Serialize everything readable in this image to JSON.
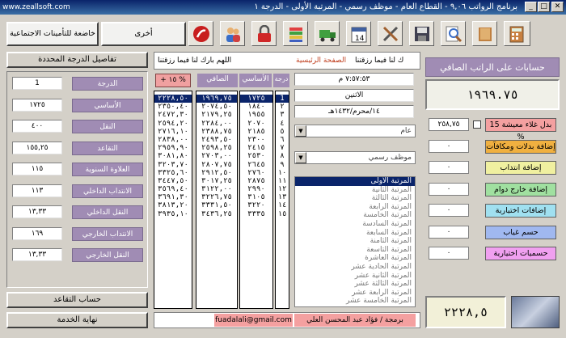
{
  "window": {
    "title": "برنامج الرواتب ٩,٠٦ - القطاع العام - موظف رسمي - المرتبة الأولى - الدرجة ١",
    "watermark": "www.zeallsoft.com",
    "min": "_",
    "max": "□",
    "close": "✕"
  },
  "toolbar": {
    "subject_label": "خاضعة للتأمينات الاجتماعية",
    "other_label": "أخرى",
    "icons": [
      "calculator-icon",
      "book-icon",
      "search-icon",
      "save-icon",
      "tools-icon",
      "calendar-icon",
      "truck-icon",
      "files-icon",
      "lock-icon",
      "users-icon",
      "help-icon"
    ]
  },
  "left": {
    "details_button": "تفاصيل الدرجة المحددة",
    "fields": [
      {
        "label": "الدرجة",
        "value": "1"
      },
      {
        "label": "الأساسي",
        "value": "١٧٢٥"
      },
      {
        "label": "النقل",
        "value": "٤٠٠"
      },
      {
        "label": "التقاعد",
        "value": "١٥٥,٢٥"
      },
      {
        "label": "العلاوة السنوية",
        "value": "١١٥"
      },
      {
        "label": "الانتداب الداخلي",
        "value": "١١٣"
      },
      {
        "label": "النقل الداخلي",
        "value": "١٣,٣٣"
      },
      {
        "label": "الانتداب الخارجي",
        "value": "١٦٩"
      },
      {
        "label": "النقل الخارجي",
        "value": "١٣,٣٣"
      }
    ],
    "retirement_button": "حساب التقاعد",
    "end_service_button": "نهاية الخدمة"
  },
  "center": {
    "marquee": "اللهم بارك لنا فيما رزقتنا",
    "marquee_main": "الصفحة الرئيسية",
    "marquee_tail": "ك لنا فيما رزقتنا",
    "plus_button": "+ ١٥ %",
    "headers": {
      "net": "الصافي",
      "basic": "الأساسي",
      "grade": "درجة"
    },
    "col_plus": [
      "٢٢٢٨,٥٠",
      "٢٣٥٠,٤٠",
      "٢٤٧٢,٣٠",
      "٢٥٩٤,٢٠",
      "٢٧١٦,١٠",
      "٢٨٣٨,٠٠",
      "٢٩٥٩,٩٠",
      "٣٠٨١,٨٠",
      "٣٢٠٣,٧٠",
      "٣٣٢٥,٦٠",
      "٣٤٤٧,٥٠",
      "٣٥٦٩,٤٠",
      "٣٦٩١,٣٠",
      "٣٨١٣,٢٠",
      "٣٩٣٥,١٠"
    ],
    "col_net": [
      "١٩٦٩,٧٥",
      "٢٠٧٤,٥٠",
      "٢١٧٩,٢٥",
      "٢٢٨٤,٠٠",
      "٢٣٨٨,٧٥",
      "٢٤٩٣,٥٠",
      "٢٥٩٨,٢٥",
      "٢٧٠٣,٠٠",
      "٢٨٠٧,٧٥",
      "٢٩١٢,٥٠",
      "٣٠١٧,٢٥",
      "٣١٢٢,٠٠",
      "٣٢٢٦,٧٥",
      "٣٣٣١,٥٠",
      "٣٤٣٦,٢٥"
    ],
    "col_basic": [
      "١٧٢٥",
      "١٨٤٠",
      "١٩٥٥",
      "٢٠٧٠",
      "٢١٨٥",
      "٢٣٠٠",
      "٢٤١٥",
      "٢٥٣٠",
      "٢٦٤٥",
      "٢٧٦٠",
      "٢٨٧٥",
      "٢٩٩٠",
      "٣١٠٥",
      "٣٢٢٠",
      "٣٣٣٥"
    ],
    "col_grade": [
      "1",
      "٢",
      "٣",
      "٤",
      "٥",
      "٦",
      "٧",
      "٨",
      "٩",
      "١٠",
      "١١",
      "١٢",
      "١٣",
      "١٤",
      "١٥"
    ],
    "time": "٧:٥٧:٥٣ م",
    "day": "الاثنين",
    "date": "١٤/محرم/١٤٣٢هـ",
    "combo_sector": "عام",
    "combo_type": "موظف رسمي",
    "ranks": [
      "المرتبة الأولى",
      "المرتبة الثانية",
      "المرتبة الثالثة",
      "المرتبة الرابعة",
      "المرتبة الخامسة",
      "المرتبة السادسة",
      "المرتبة السابعة",
      "المرتبة الثامنة",
      "المرتبة التاسعة",
      "المرتبة العاشرة",
      "المرتبة الحادية عشر",
      "المرتبة الثانية عشر",
      "المرتبة الثالثة عشر",
      "المرتبة الرابعة عشر",
      "المرتبة الخامسة عشر"
    ],
    "email": "fuadalali@gmail.com",
    "credit": "برمجة / فؤاد عبد المحسن العلي"
  },
  "right": {
    "title": "حسابات على الراتب الصافي",
    "net_total": "١٩٦٩.٧٥",
    "rows": [
      {
        "label": "بدل غلاء معيشة 15 %",
        "value": "٢٥٨,٧٥",
        "color": "#f4a0a0",
        "checkbox": true
      },
      {
        "label": "إضافة بدلات ومكافآت",
        "value": "٠",
        "color": "#f0b040"
      },
      {
        "label": "إضافة انتداب",
        "value": "٠",
        "color": "#f0f0a0"
      },
      {
        "label": "إضافة خارج دوام",
        "value": "٠",
        "color": "#a0e0a0"
      },
      {
        "label": "إضافات اختيارية",
        "value": "٠",
        "color": "#a0e0f0"
      },
      {
        "label": "حسم غياب",
        "value": "٠",
        "color": "#a0b8f0"
      },
      {
        "label": "حسميات اختيارية",
        "value": "٠",
        "color": "#f0a0f0"
      }
    ],
    "final_total": "٢٢٢٨,٥"
  }
}
